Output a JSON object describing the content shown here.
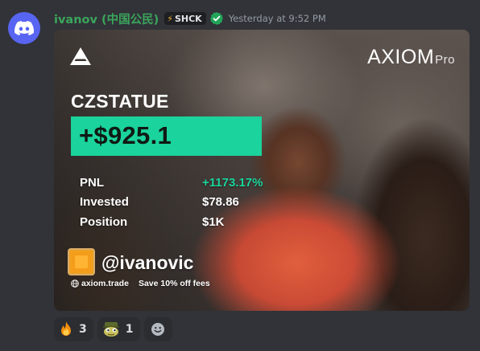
{
  "message": {
    "username": "ivanov (中国公民)",
    "server_tag": "SHCK",
    "timestamp": "Yesterday at 9:52 PM"
  },
  "card": {
    "brand": "AXIOM",
    "brand_suffix": "Pro",
    "ticker": "CZSTATUE",
    "pnl_value": "+$925.1",
    "stats": [
      {
        "label": "PNL",
        "value": "+1173.17%"
      },
      {
        "label": "Invested",
        "value": "$78.86"
      },
      {
        "label": "Position",
        "value": "$1K"
      }
    ],
    "handle": "@ivanovic",
    "site": "axiom.trade",
    "promo": "Save 10% off fees"
  },
  "reactions": [
    {
      "icon": "fire-emoji",
      "count": "3"
    },
    {
      "icon": "frog-emoji",
      "count": "1"
    }
  ],
  "colors": {
    "accent_green": "#1bd39c",
    "username_green": "#3ba55c",
    "discord_blurple": "#5865f2"
  }
}
